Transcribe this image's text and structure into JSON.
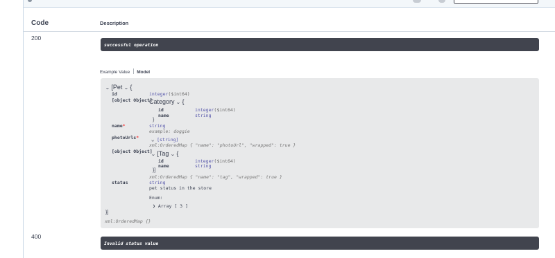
{
  "table": {
    "col_code": "Code",
    "col_description": "Description"
  },
  "responses": [
    {
      "code": "200",
      "description": "successful operation"
    },
    {
      "code": "400",
      "description": "Invalid status value"
    }
  ],
  "tabs": {
    "example": "Example Value",
    "model": "Model"
  },
  "model": {
    "root_open": "[Pet",
    "root_brace": "{",
    "root_close": "}]",
    "xml_root": "xml:OrderedMap {}",
    "fields": {
      "id": {
        "name": "id",
        "type": "integer",
        "format": "($int64)"
      },
      "category": {
        "name": {
          "name": "name",
          "type": "string"
        },
        "model": "Category",
        "brace": "{",
        "close": "}",
        "id": {
          "name": "id",
          "type": "integer",
          "format": "($int64)"
        }
      },
      "name": {
        "name": "name",
        "required": "*",
        "type": "string",
        "example": "example: doggie"
      },
      "photoUrls": {
        "name": "photoUrls",
        "required": "*",
        "type": "[string]",
        "xml": "xml:OrderedMap { \"name\": \"photoUrl\", \"wrapped\": true }"
      },
      "tags": {
        "name": {
          "name": "name",
          "type": "string"
        },
        "model": "[Tag",
        "brace": "{",
        "close": "}]",
        "id": {
          "name": "id",
          "type": "integer",
          "format": "($int64)"
        },
        "xml": "xml:OrderedMap { \"name\": \"tag\", \"wrapped\": true }"
      },
      "status": {
        "name": "status",
        "type": "string",
        "description": "pet status in the store",
        "enum_label": "Enum:",
        "enum_value": "Array [ 3 ]"
      }
    }
  },
  "icons": {
    "expand": "chevron-down-icon",
    "collapsed": "chevron-right-icon"
  }
}
